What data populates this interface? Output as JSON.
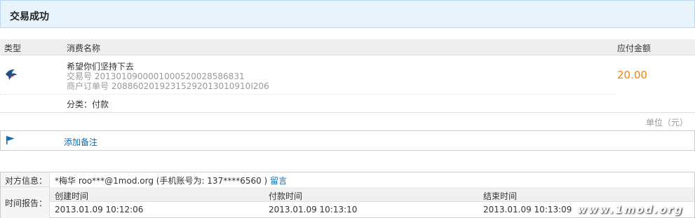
{
  "status": {
    "title": "交易成功"
  },
  "items_header": {
    "type": "类型",
    "name": "消费名称",
    "amount": "应付金额"
  },
  "item": {
    "name": "希望你们坚持下去",
    "trade_no": "交易号 2013010900001000520028586831",
    "order_no": "商户订单号 20886020192315292013010910I206",
    "amount": "20.00",
    "category": "分类：付款",
    "icon": "bird-icon"
  },
  "unit_note": "单位（元）",
  "remark": {
    "icon": "flag-icon",
    "label": "添加备注"
  },
  "counterparty": {
    "label": "对方信息：",
    "value": "*梅华 roo***@1mod.org (手机账号为: 137****6560 )",
    "message_link": "留言"
  },
  "time_report": {
    "label": "时间报告：",
    "columns": [
      "创建时间",
      "付款时间",
      "结束时间"
    ],
    "values": [
      "2013.01.09 10:12:06",
      "2013.01.09 10:13:10",
      "2013.01.09 10:13:09"
    ]
  },
  "watermark": "www.1mod.org",
  "colors": {
    "amount": "#ff7f00",
    "link": "#0b6db5",
    "status_bg": "#e8f3fc"
  }
}
